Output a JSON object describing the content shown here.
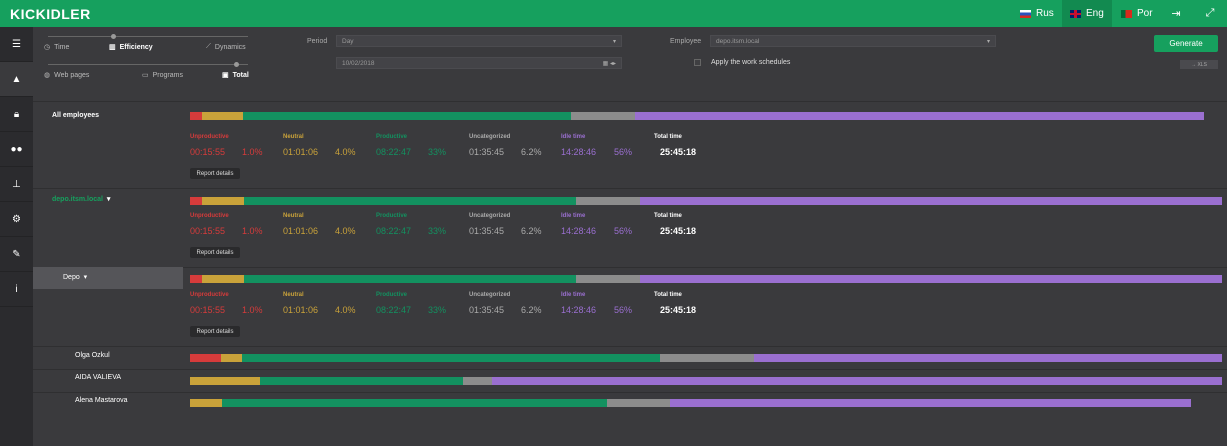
{
  "app": {
    "logo": "KICKIDLER"
  },
  "header": {
    "langs": [
      {
        "label": "Rus",
        "flag": "ru"
      },
      {
        "label": "Eng",
        "flag": "en"
      },
      {
        "label": "Por",
        "flag": "pt"
      }
    ],
    "icons": [
      "logout-icon",
      "fullscreen-icon"
    ]
  },
  "sidebar": {
    "icons": [
      "list-icon",
      "chart-icon",
      "lock-icon",
      "users-icon",
      "org-icon",
      "settings-icon",
      "wrench-icon",
      "info-icon"
    ]
  },
  "modes": {
    "row1": [
      "Time",
      "Efficiency",
      "Dynamics"
    ],
    "row2": [
      "Web pages",
      "Programs",
      "Total"
    ]
  },
  "filters": {
    "period_label": "Period",
    "period_value": "Day",
    "date_value": "10/02/2018",
    "employee_label": "Employee",
    "employee_value": "depo.itsm.local",
    "schedules_label": "Apply the work schedules",
    "generate_label": "Generate",
    "xls_label": "→ XLS"
  },
  "colors": {
    "unproductive": "#d63b3b",
    "neutral": "#c9a23a",
    "productive": "#139160",
    "uncategorized": "#8c8c8c",
    "idle": "#9a6fd0"
  },
  "stat_labels": {
    "unproductive": "Unproductive",
    "neutral": "Neutral",
    "productive": "Productive",
    "uncategorized": "Uncategorized",
    "idle": "Idle time",
    "total": "Total time"
  },
  "report_label": "Report details",
  "groups": [
    {
      "name": "All employees",
      "bar": [
        0.012,
        0.04,
        0.322,
        0.062,
        0.558
      ],
      "stats": {
        "unproductive": "00:15:55",
        "unproductive_pct": "1.0%",
        "neutral": "01:01:06",
        "neutral_pct": "4.0%",
        "productive": "08:22:47",
        "productive_pct": "33%",
        "uncategorized": "01:35:45",
        "uncategorized_pct": "6.2%",
        "idle": "14:28:46",
        "idle_pct": "56%",
        "total": "25:45:18"
      }
    },
    {
      "name": "depo.itsm.local",
      "bar": [
        0.012,
        0.04,
        0.322,
        0.062,
        0.564
      ],
      "stats": {
        "unproductive": "00:15:55",
        "unproductive_pct": "1.0%",
        "neutral": "01:01:06",
        "neutral_pct": "4.0%",
        "productive": "08:22:47",
        "productive_pct": "33%",
        "uncategorized": "01:35:45",
        "uncategorized_pct": "6.2%",
        "idle": "14:28:46",
        "idle_pct": "56%",
        "total": "25:45:18"
      }
    },
    {
      "name": "Depo",
      "bar": [
        0.012,
        0.04,
        0.322,
        0.062,
        0.564
      ],
      "stats": {
        "unproductive": "00:15:55",
        "unproductive_pct": "1.0%",
        "neutral": "01:01:06",
        "neutral_pct": "4.0%",
        "productive": "08:22:47",
        "productive_pct": "33%",
        "uncategorized": "01:35:45",
        "uncategorized_pct": "6.2%",
        "idle": "14:28:46",
        "idle_pct": "56%",
        "total": "25:45:18"
      }
    }
  ],
  "employees": [
    {
      "name": "Olga Ozkul",
      "bar": [
        0.03,
        0.02,
        0.405,
        0.092,
        0.453
      ]
    },
    {
      "name": "AIDA VALIEVA",
      "bar": [
        0,
        0.068,
        0.197,
        0.028,
        0.707
      ]
    },
    {
      "name": "Alena Mastarova",
      "bar": [
        0,
        0.032,
        0.385,
        0.063,
        0.52
      ]
    }
  ]
}
